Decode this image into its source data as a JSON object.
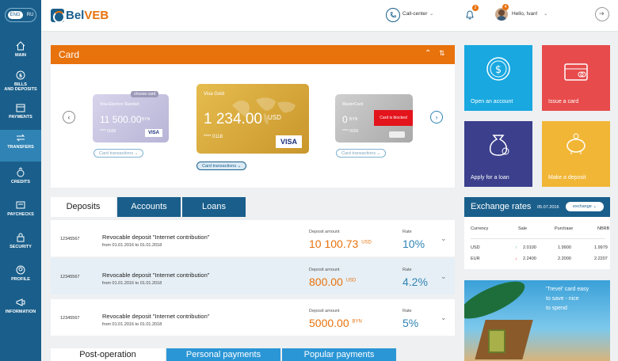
{
  "sidebar": {
    "lang_en": "ENG",
    "lang_ru": "RU",
    "items": [
      {
        "label": "MAIN",
        "icon": "home-icon"
      },
      {
        "label": "BILLS\nAND DEPOSITS",
        "l1": "BILLS",
        "l2": "AND DEPOSITS",
        "icon": "coin-icon"
      },
      {
        "label": "PAYMENTS",
        "icon": "wallet-icon"
      },
      {
        "label": "TRANSFERS",
        "icon": "transfer-icon"
      },
      {
        "label": "CREDITS",
        "icon": "credit-icon"
      },
      {
        "label": "PAYCHECKS",
        "icon": "paycheck-icon"
      },
      {
        "label": "SECURITY",
        "icon": "lock-icon"
      },
      {
        "label": "PROFILE",
        "icon": "profile-icon"
      },
      {
        "label": "INFORMATION",
        "icon": "megaphone-icon"
      }
    ]
  },
  "header": {
    "logo_bel": "Bel",
    "logo_veb": "VEB",
    "callcenter": "Call-center",
    "notif_count": "2",
    "user_badge": "4",
    "greeting": "Hello, Ivan!"
  },
  "card_panel": {
    "title": "Card",
    "choose": "choose card",
    "cards": [
      {
        "name": "Visa Electron Standart",
        "amount": "11 500.00",
        "currency": "BYN",
        "number": "**** 0030",
        "brand": "VISA",
        "tx": "Card transactions"
      },
      {
        "name": "Visa Gold",
        "amount": "1 234.00",
        "currency": "USD",
        "number": "**** 0118",
        "brand": "VISA",
        "tx": "Card transactions"
      },
      {
        "name": "MasterCard",
        "amount": "0",
        "currency": "BYN",
        "number": "**** 0026",
        "blocked": "Card is blocked",
        "tx": "Card transactions"
      }
    ]
  },
  "tiles": [
    {
      "label": "Open an account",
      "icon": "dollar-coin-icon",
      "color": "#19a8e0"
    },
    {
      "label": "Issue a card",
      "icon": "card-icon",
      "color": "#e84b4b"
    },
    {
      "label": "Apply for a loan",
      "icon": "money-bag-icon",
      "color": "#3b3f8c"
    },
    {
      "label": "Make a deposit",
      "icon": "piggy-bank-icon",
      "color": "#f2b636"
    }
  ],
  "tabs": {
    "deposits": "Deposits",
    "accounts": "Accounts",
    "loans": "Loans"
  },
  "deposits": [
    {
      "id": "12345567",
      "title": "Revocable deposit \"Internet contribution\"",
      "period": "from 01.01.2016 to 01.01.2018",
      "amount_label": "Deposit amount",
      "amount": "10 100.73",
      "currency": "USD",
      "rate_label": "Rate",
      "rate": "10%"
    },
    {
      "id": "12345567",
      "title": "Revocable deposit \"Internet contribution\"",
      "period": "from 01.01.2016 to 01.01.2018",
      "amount_label": "Deposit amount",
      "amount": "800.00",
      "currency": "USD",
      "rate_label": "Rate",
      "rate": "4.2%"
    },
    {
      "id": "12345567",
      "title": "Revocable deposit \"Internet contribution\"",
      "period": "from 01.01.2016 to 01.01.2018",
      "amount_label": "Deposit amount",
      "amount": "5000.00",
      "currency": "BYN",
      "rate_label": "Rate",
      "rate": "5%"
    }
  ],
  "exchange": {
    "title": "Exchange rates",
    "date": "05.07.2016",
    "selector": "exchange",
    "headers": {
      "currency": "Currency",
      "sale": "Sale",
      "purchase": "Purchase",
      "nbrb": "NBRB"
    },
    "rows": [
      {
        "currency": "USD",
        "dir": "↑",
        "sale": "2.0100",
        "purchase": "1.9900",
        "nbrb": "1.9979"
      },
      {
        "currency": "EUR",
        "dir": "↓",
        "sale": "2.2400",
        "purchase": "2.2000",
        "nbrb": "2.2207"
      }
    ]
  },
  "promo": {
    "line1": "'Trevel' card easy",
    "line2": "to save - nice",
    "line3": "to spend"
  },
  "bottom_tabs": {
    "post": "Post-operation",
    "personal": "Personal payments",
    "popular": "Popular payments"
  }
}
